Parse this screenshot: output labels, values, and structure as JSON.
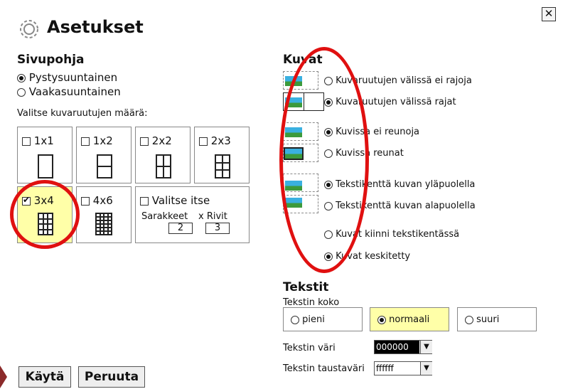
{
  "dialog": {
    "title": "Asetukset",
    "close": "✕"
  },
  "page_layout": {
    "heading": "Sivupohja",
    "orientation": [
      {
        "label": "Pystysuuntainen",
        "selected": true
      },
      {
        "label": "Vaakasuuntainen",
        "selected": false
      }
    ],
    "grid_prompt": "Valitse kuvaruutujen määrä:",
    "tiles": [
      {
        "label": "1x1",
        "checked": false
      },
      {
        "label": "1x2",
        "checked": false
      },
      {
        "label": "2x2",
        "checked": false
      },
      {
        "label": "2x3",
        "checked": false
      },
      {
        "label": "3x4",
        "checked": true
      },
      {
        "label": "4x6",
        "checked": false
      }
    ],
    "custom": {
      "label": "Valitse itse",
      "columns_label": "Sarakkeet",
      "rows_label": "x Rivit",
      "columns": "2",
      "rows": "3"
    }
  },
  "images": {
    "heading": "Kuvat",
    "options": [
      {
        "label": "Kuvaruutujen välissä ei rajoja",
        "selected": false
      },
      {
        "label": "Kuvaruutujen välissä rajat",
        "selected": true
      },
      {
        "label": "Kuvissa ei reunoja",
        "selected": true
      },
      {
        "label": "Kuvissa reunat",
        "selected": false
      },
      {
        "label": "Tekstikenttä kuvan yläpuolella",
        "selected": true
      },
      {
        "label": "Tekstikenttä kuvan alapuolella",
        "selected": false
      },
      {
        "label": "Kuvat kiinni tekstikentässä",
        "selected": false
      },
      {
        "label": "Kuvat keskitetty",
        "selected": true
      }
    ]
  },
  "texts": {
    "heading": "Tekstit",
    "size_label": "Tekstin koko",
    "sizes": [
      {
        "label": "pieni",
        "selected": false
      },
      {
        "label": "normaali",
        "selected": true
      },
      {
        "label": "suuri",
        "selected": false
      }
    ],
    "color_label": "Tekstin väri",
    "color_value": "000000",
    "bg_label": "Tekstin taustaväri",
    "bg_value": "ffffff"
  },
  "buttons": {
    "apply": "Käytä",
    "cancel": "Peruuta"
  },
  "colors": {
    "highlight": "#ffffa8",
    "annotation": "#e01010"
  }
}
